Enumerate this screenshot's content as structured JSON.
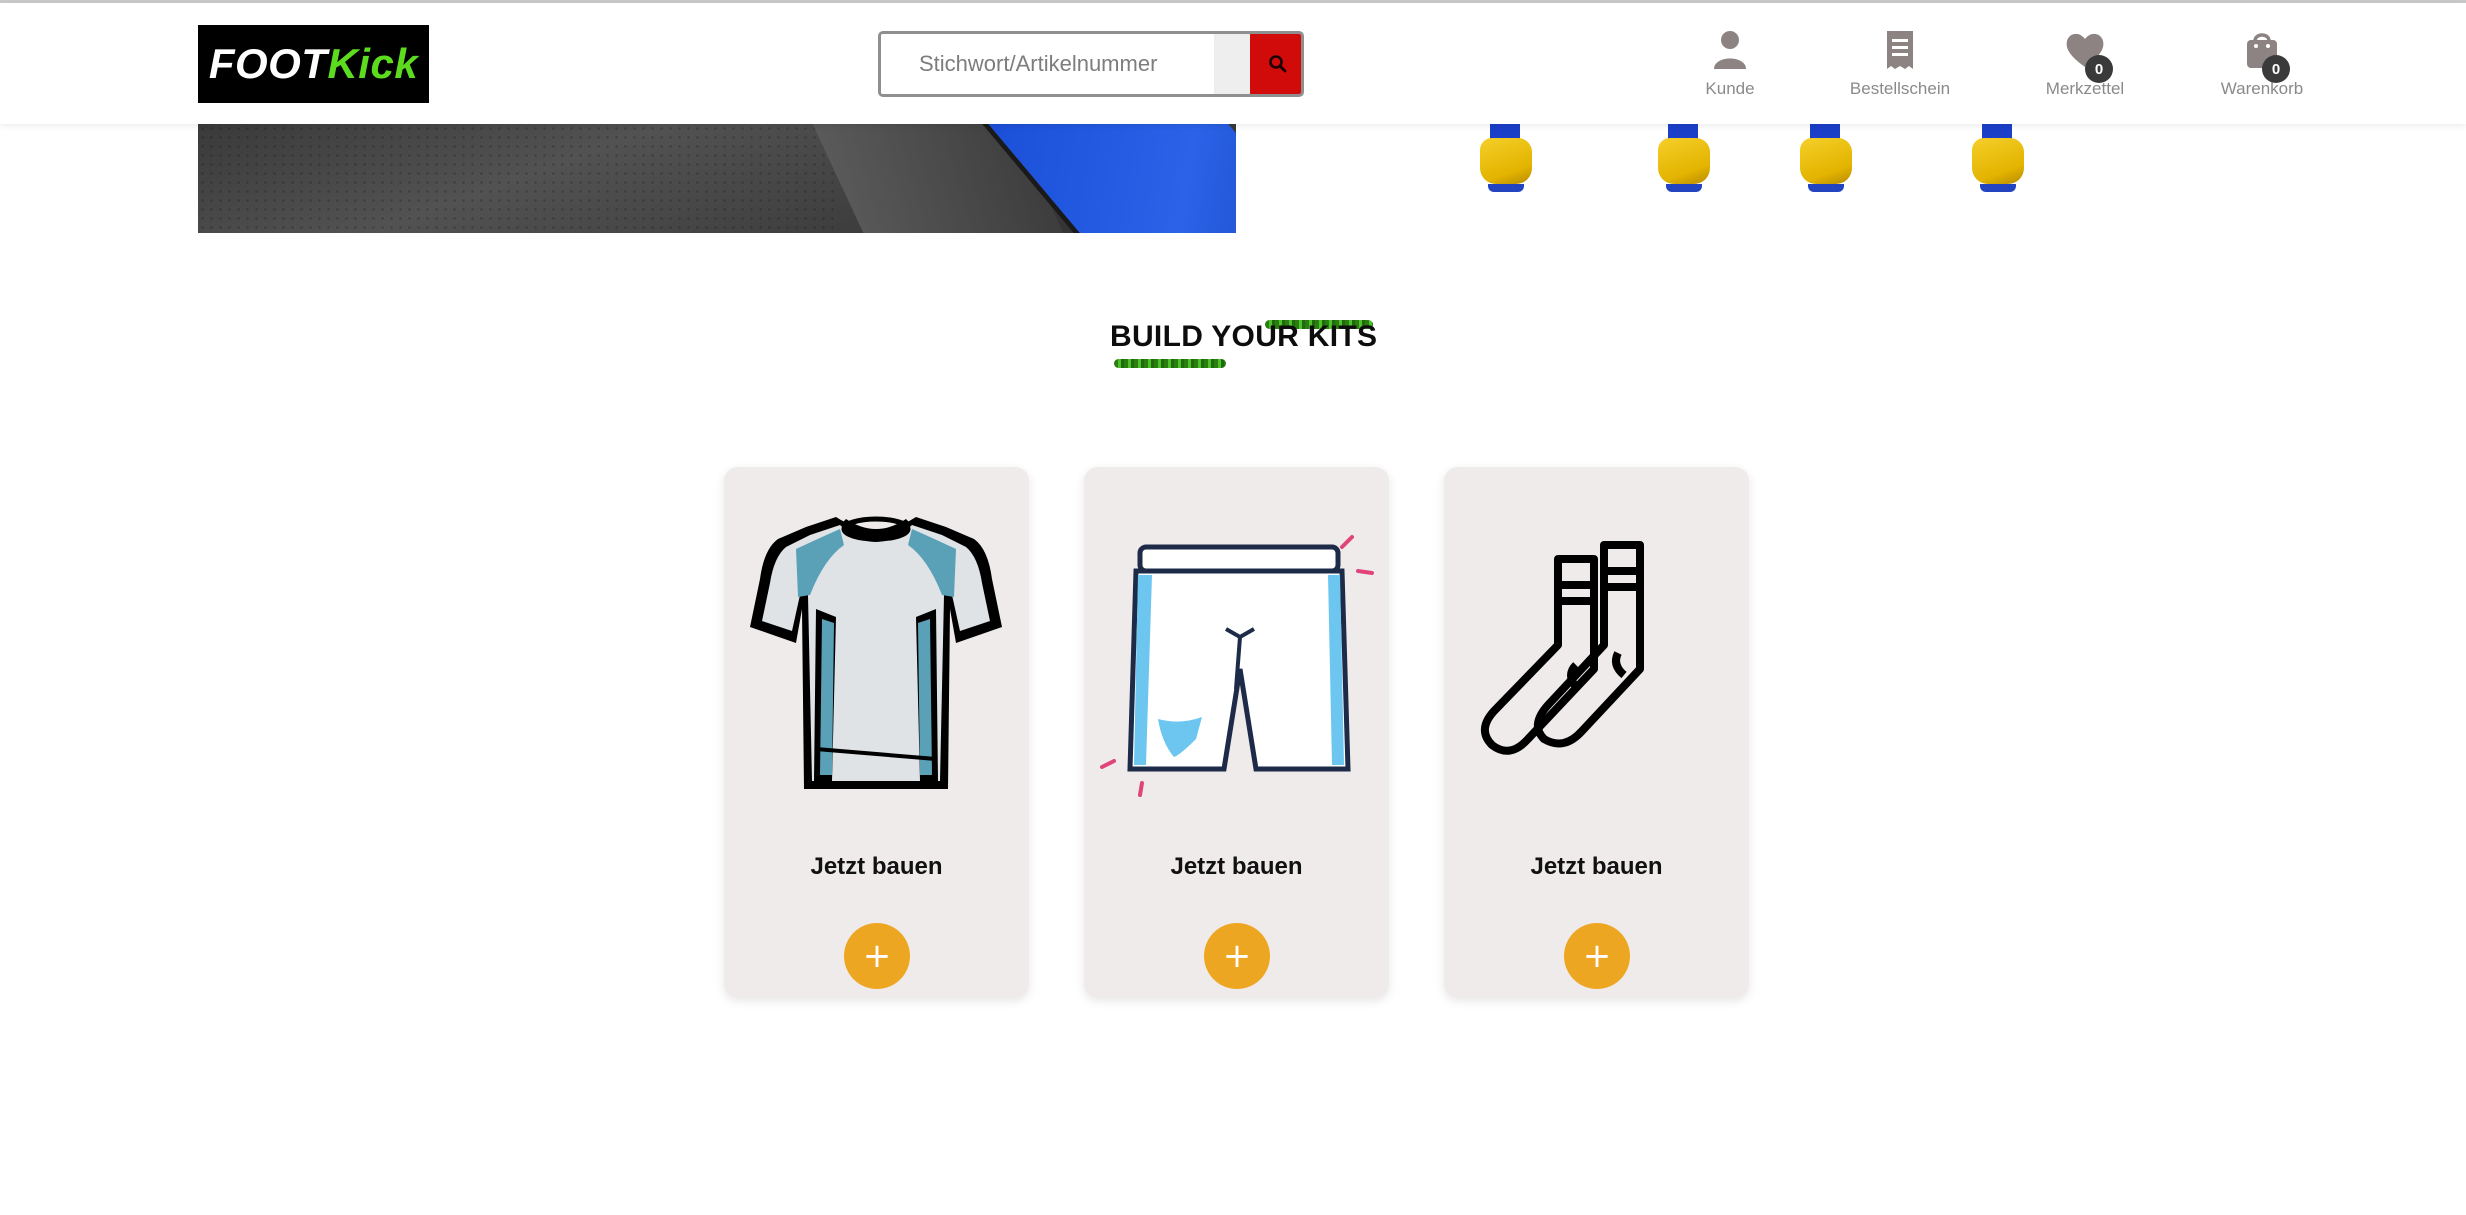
{
  "brand": {
    "logo_part1": "FOOT",
    "logo_part2": "Kick"
  },
  "search": {
    "placeholder": "Stichwort/Artikelnummer",
    "button_icon": "search-icon"
  },
  "header_icons": [
    {
      "label": "Kunde",
      "icon": "user-icon"
    },
    {
      "label": "Bestellschein",
      "icon": "receipt-icon"
    },
    {
      "label": "Merkzettel",
      "icon": "heart-icon",
      "count": "0"
    },
    {
      "label": "Warenkorb",
      "icon": "shopping-bag-icon",
      "count": "0"
    }
  ],
  "section": {
    "title": "BUILD YOUR KITS"
  },
  "cards": [
    {
      "icon": "jersey-icon",
      "cta": "Jetzt bauen",
      "button": "+"
    },
    {
      "icon": "shorts-icon",
      "cta": "Jetzt bauen",
      "button": "+"
    },
    {
      "icon": "socks-icon",
      "cta": "Jetzt bauen",
      "button": "+"
    }
  ],
  "colors": {
    "brand_green": "#5ddb1f",
    "search_button": "#d10a0a",
    "accent_orange": "#eda621",
    "card_bg": "#efebea"
  }
}
